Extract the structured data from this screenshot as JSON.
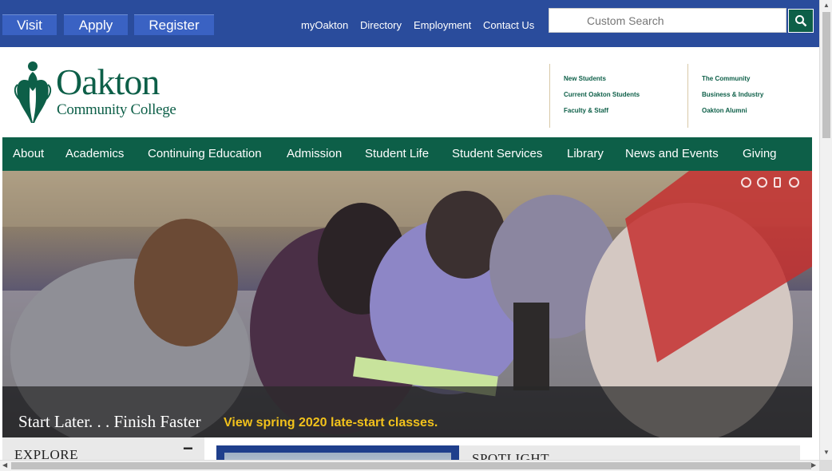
{
  "topbar": {
    "buttons": [
      "Visit",
      "Apply",
      "Register"
    ],
    "links": [
      "myOakton",
      "Directory",
      "Employment",
      "Contact Us"
    ],
    "search": {
      "placeholder": "Custom Search",
      "icon": "search-icon"
    }
  },
  "logo": {
    "name": "Oakton",
    "subtitle": "Community College",
    "icon": "oak-leaf-logo"
  },
  "audiences": {
    "col1": [
      "New Students",
      "Current Oakton Students",
      "Faculty & Staff"
    ],
    "col2": [
      "The Community",
      "Business & Industry",
      "Oakton Alumni"
    ]
  },
  "nav": [
    "About",
    "Academics",
    "Continuing Education",
    "Admission",
    "Student Life",
    "Student Services",
    "Library",
    "News and Events",
    "Giving"
  ],
  "hero": {
    "headline": "Start Later. . . Finish Faster",
    "link": "View spring 2020 late-start classes."
  },
  "explore": {
    "title": "EXPLORE",
    "toggle": "−"
  },
  "spotlight": {
    "title": "SPOTLIGHT"
  },
  "colors": {
    "brand_green": "#0d5f48",
    "topbar_blue": "#2a4c9c",
    "accent_yellow": "#f2c21b"
  }
}
